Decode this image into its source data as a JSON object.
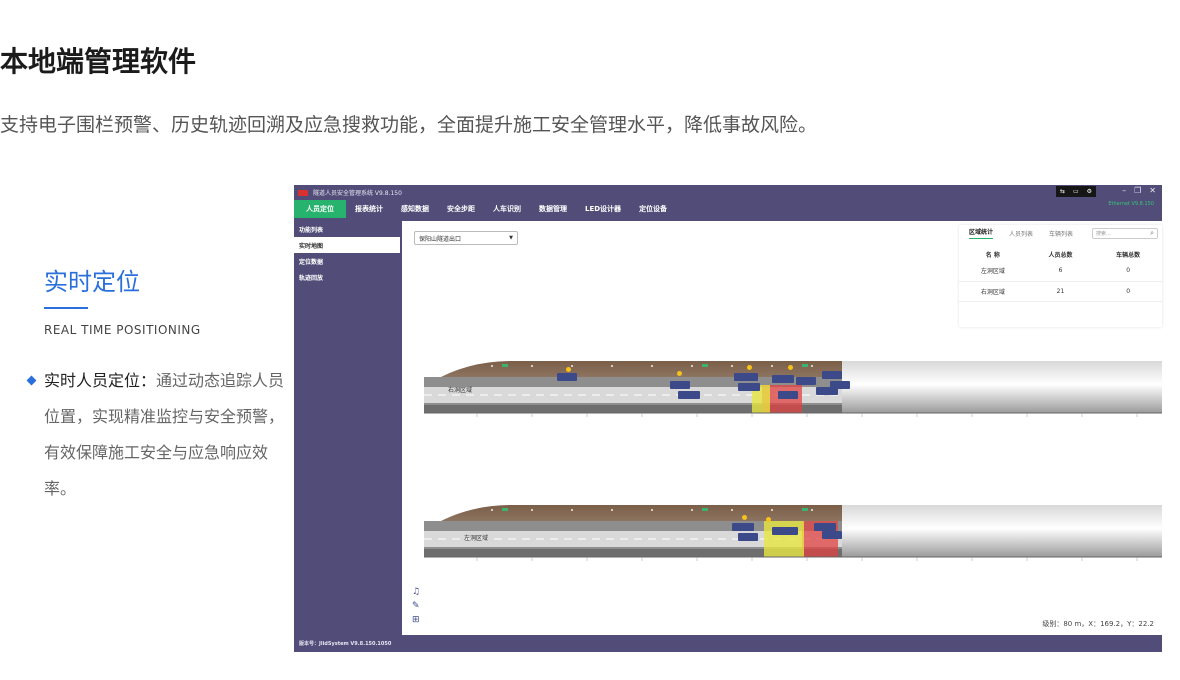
{
  "page": {
    "title": "本地端管理软件",
    "subtitle": "支持电子围栏预警、历史轨迹回溯及应急搜救功能，全面提升施工安全管理水平，降低事故风险。"
  },
  "feature": {
    "title": "实时定位",
    "subtitle_en": "REAL TIME POSITIONING",
    "desc_highlight": "实时人员定位：",
    "desc_body": "通过动态追踪人员位置，实现精准监控与安全预警，有效保障施工安全与应急响应效率。"
  },
  "app": {
    "title": "隧道人员安全管理系统 V9.8.150",
    "tray_icons": [
      "network-icon",
      "monitor-icon",
      "gear-icon"
    ],
    "green_text": "Ethernet V9.8.150",
    "menu": [
      "人员定位",
      "报表统计",
      "感知数据",
      "安全步距",
      "人车识别",
      "数据管理",
      "LED设计器",
      "定位设备"
    ],
    "sidebar": [
      "功能列表",
      "实时地图",
      "定位数据",
      "轨迹回放"
    ],
    "location": "保阳山隧道出口",
    "stats_tabs": [
      "区域统计",
      "人员列表",
      "车辆列表"
    ],
    "search_placeholder": "搜索...",
    "stats_headers": [
      "名 称",
      "人员总数",
      "车辆总数"
    ],
    "stats_rows": [
      [
        "左洞区域",
        "6",
        "0"
      ],
      [
        "右洞区域",
        "21",
        "0"
      ]
    ],
    "tunnel_labels": [
      "右洞区域",
      "左洞区域"
    ],
    "coords": "级别：80 m，X：169.2，Y：22.2",
    "version": "版本号：JlidSystem V9.8.150.1050",
    "colors": {
      "frame": "#524d78",
      "active_menu": "#27b26d",
      "tag": "#3c4a8a"
    }
  }
}
